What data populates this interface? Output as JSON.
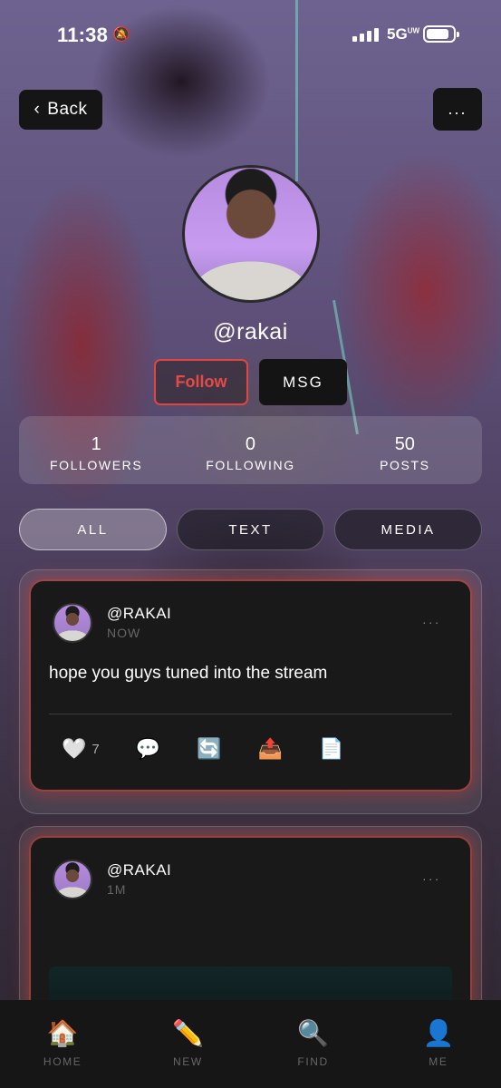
{
  "status_bar": {
    "time": "11:38",
    "network": "5G",
    "network_suffix": "UW"
  },
  "top": {
    "back_label": "Back",
    "more_label": "..."
  },
  "profile": {
    "handle": "@rakai",
    "follow_label": "Follow",
    "msg_label": "MSG",
    "stats": [
      {
        "value": "1",
        "label": "FOLLOWERS"
      },
      {
        "value": "0",
        "label": "FOLLOWING"
      },
      {
        "value": "50",
        "label": "POSTS"
      }
    ]
  },
  "tabs": [
    {
      "label": "ALL",
      "active": true
    },
    {
      "label": "TEXT",
      "active": false
    },
    {
      "label": "MEDIA",
      "active": false
    }
  ],
  "posts": [
    {
      "user": "@RAKAI",
      "time": "NOW",
      "text": "hope you guys tuned into the stream",
      "likes": "7"
    },
    {
      "user": "@RAKAI",
      "time": "1M"
    }
  ],
  "nav": [
    {
      "label": "HOME",
      "icon": "house-icon"
    },
    {
      "label": "NEW",
      "icon": "pencil-icon"
    },
    {
      "label": "FIND",
      "icon": "magnifier-icon"
    },
    {
      "label": "ME",
      "icon": "user-silhouette-icon"
    }
  ],
  "colors": {
    "follow_accent": "#e64a44",
    "card_glow": "#be3c32",
    "surface": "#191919"
  }
}
